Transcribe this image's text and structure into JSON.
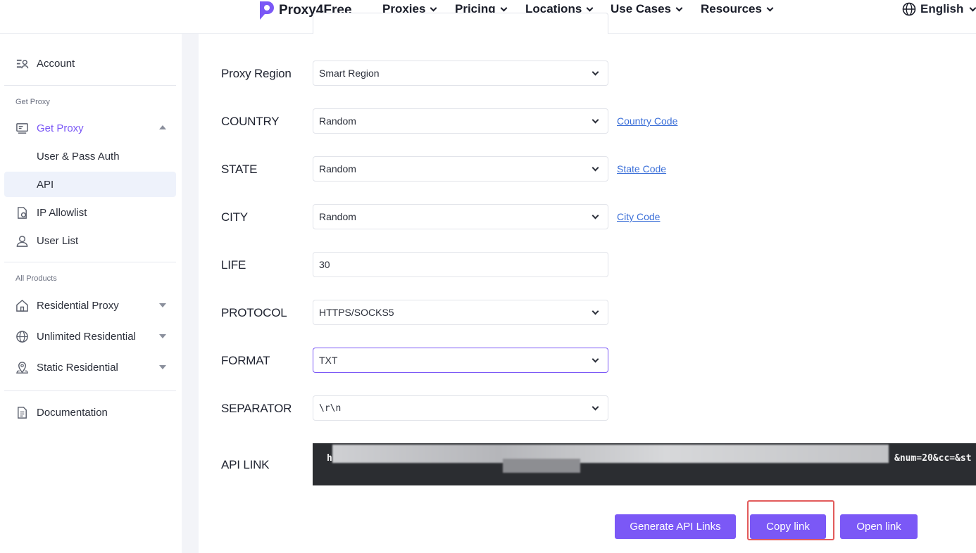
{
  "brand": {
    "name": "Proxy4Free",
    "color": "#7b58f6"
  },
  "nav": {
    "items": [
      "Proxies",
      "Pricing",
      "Locations",
      "Use Cases",
      "Resources"
    ],
    "language": "English"
  },
  "sidebar": {
    "account": "Account",
    "section_get_proxy": "Get Proxy",
    "get_proxy": "Get Proxy",
    "user_pass_auth": "User & Pass Auth",
    "api": "API",
    "ip_allowlist": "IP Allowlist",
    "user_list": "User List",
    "section_all_products": "All Products",
    "residential_proxy": "Residential Proxy",
    "unlimited_residential": "Unlimited Residential",
    "static_residential": "Static Residential",
    "documentation": "Documentation"
  },
  "form": {
    "proxy_region": {
      "label": "Proxy Region",
      "value": "Smart Region"
    },
    "country": {
      "label": "COUNTRY",
      "value": "Random",
      "link": "Country Code"
    },
    "state": {
      "label": "STATE",
      "value": "Random",
      "link": "State Code"
    },
    "city": {
      "label": "CITY",
      "value": "Random",
      "link": "City Code"
    },
    "life": {
      "label": "LIFE",
      "value": "30"
    },
    "protocol": {
      "label": "PROTOCOL",
      "value": "HTTPS/SOCKS5"
    },
    "format": {
      "label": "FORMAT",
      "value": "TXT"
    },
    "separator": {
      "label": "SEPARATOR",
      "value": "\\r\\n"
    },
    "api_link": {
      "label": "API LINK",
      "prefix": "h",
      "tail": "&num=20&cc=&st"
    }
  },
  "buttons": {
    "generate": "Generate API Links",
    "copy": "Copy link",
    "open": "Open link"
  }
}
